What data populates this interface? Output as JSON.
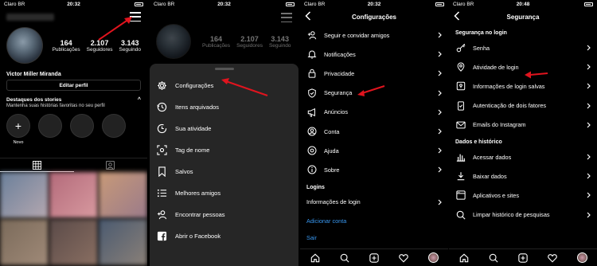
{
  "status": {
    "p1": {
      "carrier": "Claro BR",
      "time": "20:32"
    },
    "p2": {
      "carrier": "Claro BR",
      "time": "20:32"
    },
    "p3": {
      "carrier": "Claro BR",
      "time": "20:32"
    },
    "p4": {
      "carrier": "Claro BR",
      "time": "20:48"
    }
  },
  "profile": {
    "posts_count": "164",
    "posts_label": "Publicações",
    "followers_count": "2.107",
    "followers_label": "Seguidores",
    "following_count": "3.143",
    "following_label": "Seguindo",
    "name": "Victor  Miller Miranda",
    "edit_label": "Editar perfil",
    "highlights_title": "Destaques dos stories",
    "highlights_sub": "Mantenha suas histórias favoritas no seu perfil",
    "new_label": "Novo",
    "highlight_collapse": "^"
  },
  "menu": {
    "items": [
      {
        "label": "Configurações",
        "icon": "gear-icon"
      },
      {
        "label": "Itens arquivados",
        "icon": "archive-icon"
      },
      {
        "label": "Sua atividade",
        "icon": "activity-icon"
      },
      {
        "label": "Tag de nome",
        "icon": "nametag-icon"
      },
      {
        "label": "Salvos",
        "icon": "bookmark-icon"
      },
      {
        "label": "Melhores amigos",
        "icon": "list-icon"
      },
      {
        "label": "Encontrar pessoas",
        "icon": "add-person-icon"
      },
      {
        "label": "Abrir o Facebook",
        "icon": "facebook-icon"
      }
    ]
  },
  "settings": {
    "title": "Configurações",
    "items": [
      {
        "label": "Seguir e convidar amigos",
        "icon": "add-person-icon"
      },
      {
        "label": "Notificações",
        "icon": "bell-icon"
      },
      {
        "label": "Privacidade",
        "icon": "lock-icon"
      },
      {
        "label": "Segurança",
        "icon": "shield-icon"
      },
      {
        "label": "Anúncios",
        "icon": "megaphone-icon"
      },
      {
        "label": "Conta",
        "icon": "person-icon"
      },
      {
        "label": "Ajuda",
        "icon": "help-icon"
      },
      {
        "label": "Sobre",
        "icon": "info-icon"
      }
    ],
    "logins_header": "Logins",
    "login_info": "Informações de login",
    "add_account": "Adicionar conta",
    "logout": "Sair"
  },
  "security": {
    "title": "Segurança",
    "login_header": "Segurança no login",
    "login_items": [
      {
        "label": "Senha",
        "icon": "key-icon"
      },
      {
        "label": "Atividade de login",
        "icon": "location-pin-icon"
      },
      {
        "label": "Informações de login salvas",
        "icon": "keyhole-icon"
      },
      {
        "label": "Autenticação de dois fatores",
        "icon": "phone-check-icon"
      },
      {
        "label": "Emails do Instagram",
        "icon": "mail-icon"
      }
    ],
    "data_header": "Dados e histórico",
    "data_items": [
      {
        "label": "Acessar dados",
        "icon": "bar-chart-icon"
      },
      {
        "label": "Baixar dados",
        "icon": "download-icon"
      },
      {
        "label": "Aplicativos e sites",
        "icon": "apps-icon"
      },
      {
        "label": "Limpar histórico de pesquisas",
        "icon": "search-icon"
      }
    ]
  },
  "colors": {
    "accent_blue": "#3897f0",
    "arrow_red": "#e0141e",
    "sheet_bg": "#262626"
  }
}
